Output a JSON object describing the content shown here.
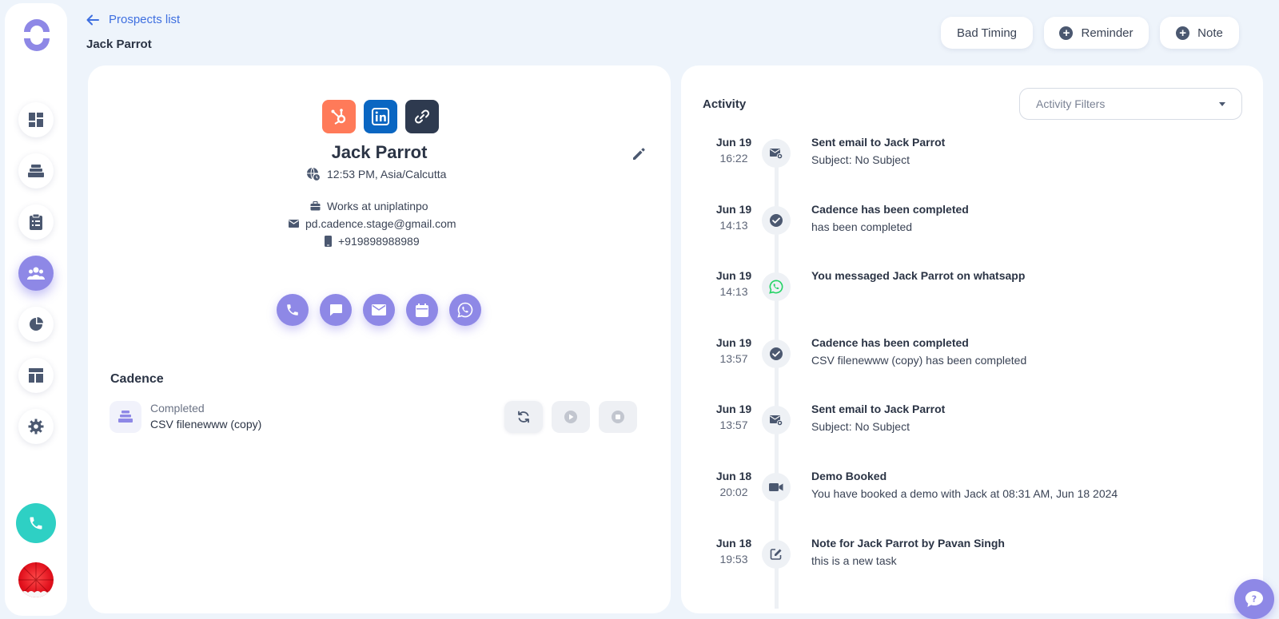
{
  "nav": {
    "back_label": "Prospects list",
    "items": [
      "dashboard",
      "cadences",
      "tasks",
      "people",
      "reports",
      "templates",
      "settings"
    ]
  },
  "page": {
    "title": "Jack Parrot"
  },
  "header_buttons": {
    "bad_timing": "Bad Timing",
    "reminder": "Reminder",
    "note": "Note"
  },
  "prospect": {
    "name": "Jack Parrot",
    "timezone": "12:53 PM, Asia/Calcutta",
    "company": "Works at uniplatinpo",
    "email": "pd.cadence.stage@gmail.com",
    "phone": "+919898988989"
  },
  "cadence": {
    "section_title": "Cadence",
    "status": "Completed",
    "name": "CSV filenewww (copy)"
  },
  "activity": {
    "title": "Activity",
    "filter_placeholder": "Activity Filters",
    "events": [
      {
        "date": "Jun 19",
        "time": "16:22",
        "icon": "email-sent-icon",
        "title": "Sent email to Jack Parrot",
        "subtitle": "Subject: No Subject"
      },
      {
        "date": "Jun 19",
        "time": "14:13",
        "icon": "check-circle-icon",
        "title": "Cadence has been completed",
        "subtitle": "has been completed"
      },
      {
        "date": "Jun 19",
        "time": "14:13",
        "icon": "whatsapp-icon",
        "title": "You messaged Jack Parrot on whatsapp",
        "subtitle": ""
      },
      {
        "date": "Jun 19",
        "time": "13:57",
        "icon": "check-circle-icon",
        "title": "Cadence has been completed",
        "subtitle": "CSV filenewww (copy) has been completed"
      },
      {
        "date": "Jun 19",
        "time": "13:57",
        "icon": "email-sent-icon",
        "title": "Sent email to Jack Parrot",
        "subtitle": "Subject: No Subject"
      },
      {
        "date": "Jun 18",
        "time": "20:02",
        "icon": "video-icon",
        "title": "Demo Booked",
        "subtitle": "You have booked a demo with Jack at 08:31 AM, Jun 18 2024"
      },
      {
        "date": "Jun 18",
        "time": "19:53",
        "icon": "note-edit-icon",
        "title": "Note for Jack Parrot by Pavan Singh",
        "subtitle": "this is a new task"
      }
    ]
  },
  "colors": {
    "accent": "#8e88e6",
    "link": "#3e6fe0",
    "call_fab": "#2ed0c4",
    "hubspot": "#ff7a59",
    "linkedin": "#0a66c2",
    "whatsapp": "#25d366"
  }
}
